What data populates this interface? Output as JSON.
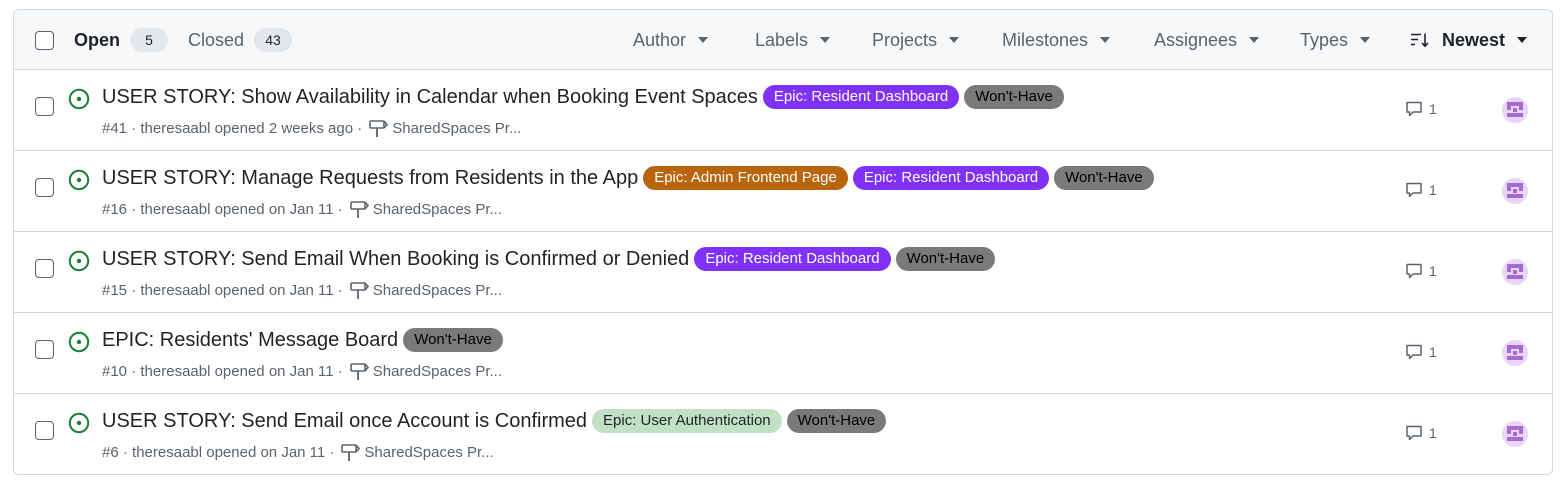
{
  "header": {
    "states": [
      {
        "label": "Open",
        "count": "5"
      },
      {
        "label": "Closed",
        "count": "43"
      }
    ],
    "filters": [
      "Author",
      "Labels",
      "Projects",
      "Milestones",
      "Assignees",
      "Types"
    ],
    "sort_label": "Newest"
  },
  "issues": [
    {
      "title": "USER STORY: Show Availability in Calendar when Booking Event Spaces",
      "labels": [
        {
          "text": "Epic: Resident Dashboard",
          "bg": "#8031f7",
          "fg": "#ffffff"
        },
        {
          "text": "Won't-Have",
          "bg": "#7a7a7a",
          "fg": "#000000"
        }
      ],
      "number": "#41",
      "meta": "theresaabl opened 2 weeks ago",
      "milestone": "SharedSpaces Pr...",
      "comments": "1"
    },
    {
      "title": "USER STORY: Manage Requests from Residents in the App",
      "labels": [
        {
          "text": "Epic: Admin Frontend Page",
          "bg": "#b8650d",
          "fg": "#ffffff"
        },
        {
          "text": "Epic: Resident Dashboard",
          "bg": "#8031f7",
          "fg": "#ffffff"
        },
        {
          "text": "Won't-Have",
          "bg": "#7a7a7a",
          "fg": "#000000"
        }
      ],
      "number": "#16",
      "meta": "theresaabl opened on Jan 11",
      "milestone": "SharedSpaces Pr...",
      "comments": "1"
    },
    {
      "title": "USER STORY: Send Email When Booking is Confirmed or Denied",
      "labels": [
        {
          "text": "Epic: Resident Dashboard",
          "bg": "#8031f7",
          "fg": "#ffffff"
        },
        {
          "text": "Won't-Have",
          "bg": "#7a7a7a",
          "fg": "#000000"
        }
      ],
      "number": "#15",
      "meta": "theresaabl opened on Jan 11",
      "milestone": "SharedSpaces Pr...",
      "comments": "1"
    },
    {
      "title": "EPIC: Residents' Message Board",
      "labels": [
        {
          "text": "Won't-Have",
          "bg": "#7a7a7a",
          "fg": "#000000"
        }
      ],
      "number": "#10",
      "meta": "theresaabl opened on Jan 11",
      "milestone": "SharedSpaces Pr...",
      "comments": "1"
    },
    {
      "title": "USER STORY: Send Email once Account is Confirmed",
      "labels": [
        {
          "text": "Epic: User Authentication",
          "bg": "#c2e0c6",
          "fg": "#1f2328"
        },
        {
          "text": "Won't-Have",
          "bg": "#7a7a7a",
          "fg": "#000000"
        }
      ],
      "number": "#6",
      "meta": "theresaabl opened on Jan 11",
      "milestone": "SharedSpaces Pr...",
      "comments": "1"
    }
  ],
  "colors": {
    "open_state": "#1a7f37",
    "avatar": "#a66ad1"
  },
  "icons": {
    "open": "issue-opened-icon",
    "milestone": "milestone-icon",
    "comment": "comment-icon",
    "sort": "sort-desc-icon"
  }
}
